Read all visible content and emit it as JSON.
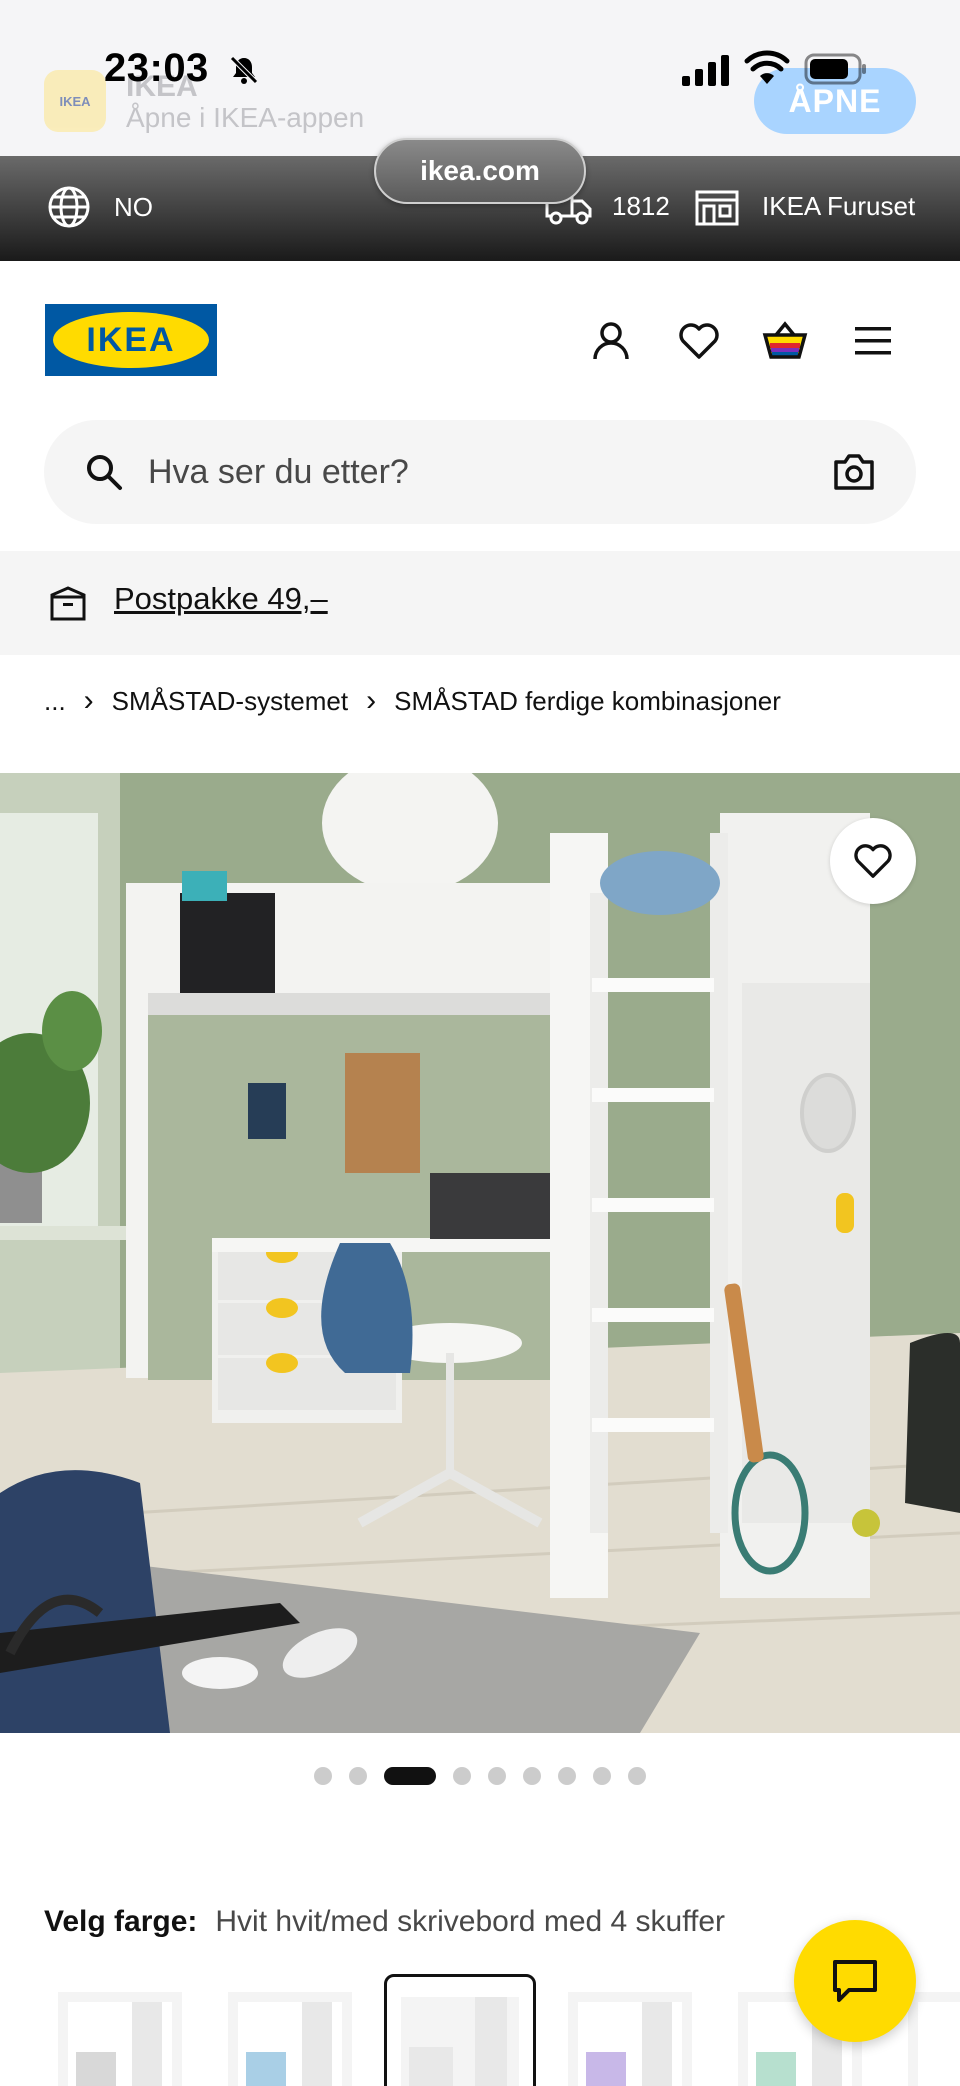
{
  "status_bar": {
    "time": "23:03"
  },
  "app_banner": {
    "icon_text": "IKEA",
    "app_name": "IKEA",
    "subtitle": "Åpne i IKEA-appen",
    "open_label": "ÅPNE"
  },
  "browser": {
    "url": "ikea.com"
  },
  "top_bar": {
    "language": "NO",
    "postcode": "1812",
    "store": "IKEA Furuset"
  },
  "header": {
    "logo_text": "IKEA",
    "icons": [
      "account-icon",
      "heart-icon",
      "basket-icon",
      "menu-icon"
    ]
  },
  "search": {
    "placeholder": "Hva ser du etter?"
  },
  "promo": {
    "text": "Postpakke 49,–"
  },
  "breadcrumb": {
    "items": [
      "...",
      "SMÅSTAD-systemet",
      "SMÅSTAD ferdige kombinasjoner"
    ],
    "separator": "›"
  },
  "product": {
    "image_alt": "SMÅSTAD loft bed with desk and 4 drawers",
    "carousel": {
      "total": 9,
      "active_index": 2
    }
  },
  "color": {
    "label": "Velg farge:",
    "value": "Hvit hvit/med skrivebord med 4 skuffer",
    "swatch_accents": [
      "#d8d8d8",
      "#a9cfe6",
      "#e8e8e8",
      "#c8b8e8",
      "#b7e0cf",
      "#d8d8d8"
    ],
    "selected_index": 2
  },
  "colors": {
    "accent_yellow": "#ffdb00",
    "ikea_blue": "#0058a3"
  }
}
